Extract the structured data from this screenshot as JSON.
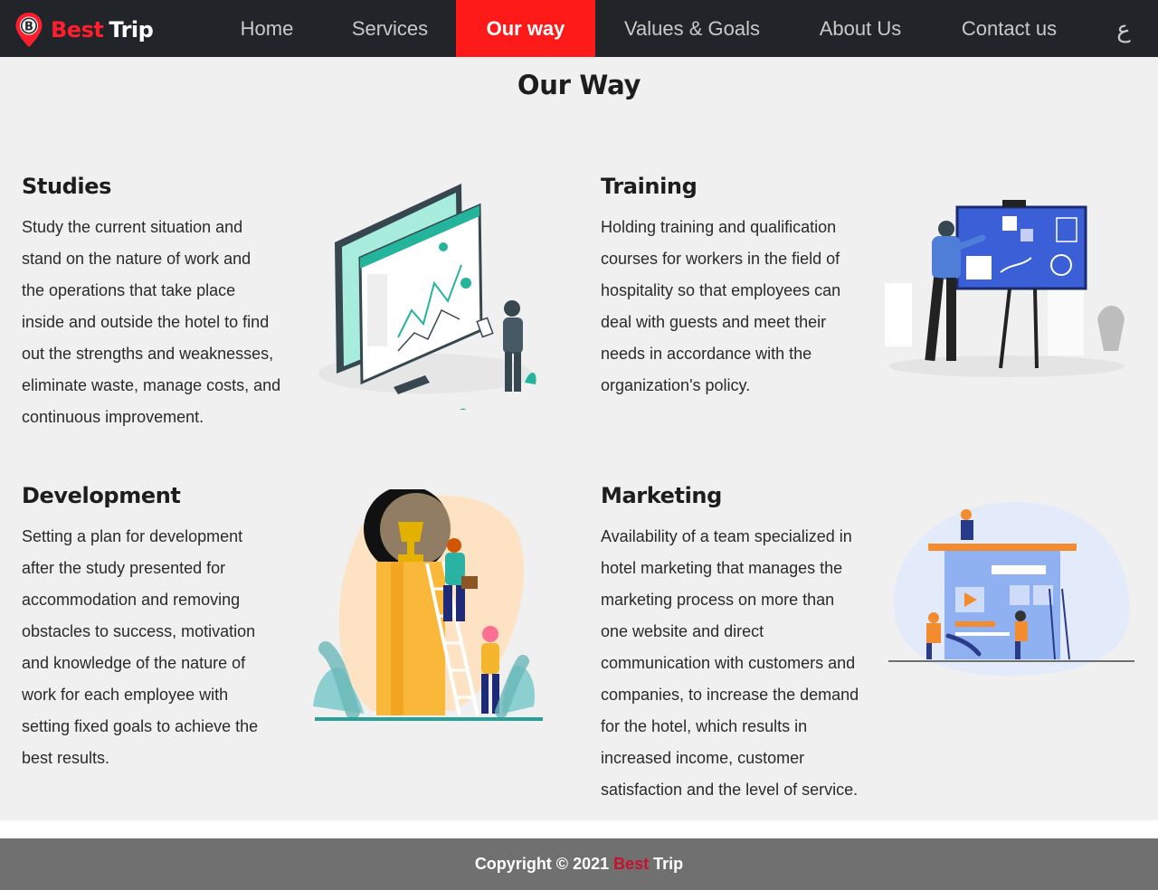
{
  "brand": {
    "logo_letter": "B",
    "name_part1": "Best",
    "name_part2": "Trip"
  },
  "nav": {
    "items": [
      {
        "label": "Home",
        "active": false
      },
      {
        "label": "Services",
        "active": false
      },
      {
        "label": "Our way",
        "active": true
      },
      {
        "label": "Values & Goals",
        "active": false
      },
      {
        "label": "About Us",
        "active": false
      },
      {
        "label": "Contact us",
        "active": false
      }
    ],
    "language_toggle": "ع"
  },
  "page": {
    "title": "Our Way",
    "blocks": [
      {
        "title": "Studies",
        "lines": [
          "Study the current situation and",
          "stand on the nature of work and",
          "the operations that take place",
          "inside and outside the hotel to find",
          "out the strengths and weaknesses,",
          "eliminate waste, manage costs, and",
          "continuous improvement."
        ],
        "illustration": "data-analysis-illustration"
      },
      {
        "title": "Training",
        "lines": [
          "Holding training and qualification",
          "courses for workers in the field of",
          "hospitality so that employees can",
          "deal with guests and meet their",
          "needs in accordance with the",
          "organization's policy."
        ],
        "illustration": "presentation-board-illustration"
      },
      {
        "title": "Development",
        "lines": [
          "Setting a plan for development",
          "after the study presented for",
          "accommodation and removing",
          "obstacles to success, motivation",
          "and knowledge of the nature of",
          "work for each employee with",
          "setting fixed goals to achieve the",
          "best results."
        ],
        "illustration": "trophy-ladder-illustration"
      },
      {
        "title": "Marketing",
        "lines": [
          "Availability of a team specialized in",
          "hotel marketing that manages the",
          "marketing process on more than",
          "one website and direct",
          "communication with customers and",
          "companies, to increase the demand",
          "for the hotel, which results in",
          "increased income, customer",
          "satisfaction and the level of service."
        ],
        "illustration": "web-team-illustration"
      }
    ]
  },
  "footer": {
    "copyright": "Copyright © 2021",
    "brand_part1": "Best",
    "brand_part2": "Trip"
  },
  "colors": {
    "navbar_bg": "#212529",
    "active_nav": "#ff1a1a",
    "brand_red": "#ff1e2d",
    "main_bg": "#f0f0f0",
    "footer_bg": "#707070"
  }
}
